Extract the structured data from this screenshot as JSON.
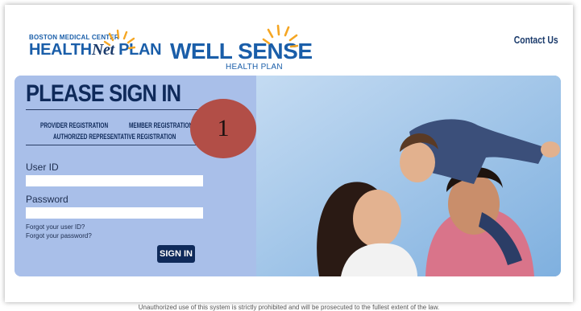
{
  "header": {
    "logo1": {
      "top": "BOSTON MEDICAL CENTER",
      "main_a": "HEALTH",
      "main_b": "Net",
      "main_c": " PLAN"
    },
    "logo2": {
      "main": "WELL SENSE",
      "sub": "HEALTH PLAN"
    },
    "contact_label": "Contact Us"
  },
  "signin": {
    "title": "PLEASE SIGN IN",
    "provider_registration": "PROVIDER REGISTRATION",
    "member_registration": "MEMBER REGISTRATION",
    "authorized_registration": "AUTHORIZED REPRESENTATIVE REGISTRATION",
    "user_id_label": "User ID",
    "user_id_value": "",
    "password_label": "Password",
    "password_value": "",
    "forgot_user": "Forgot your user ID?",
    "forgot_password": "Forgot your password?",
    "button_label": "SIGN IN"
  },
  "annotation": {
    "number": "1",
    "color": "#b24e47"
  },
  "footer": {
    "text": "Unauthorized use of this system is strictly prohibited and will be prosecuted to the fullest extent of the law."
  },
  "colors": {
    "brand_blue": "#1a5ea9",
    "navy": "#0f2a5a",
    "panel": "#a9bfe9",
    "sun": "#f5a623"
  },
  "icons": {
    "logo_sun": "sun-rays-icon",
    "photo": "family-photo"
  }
}
